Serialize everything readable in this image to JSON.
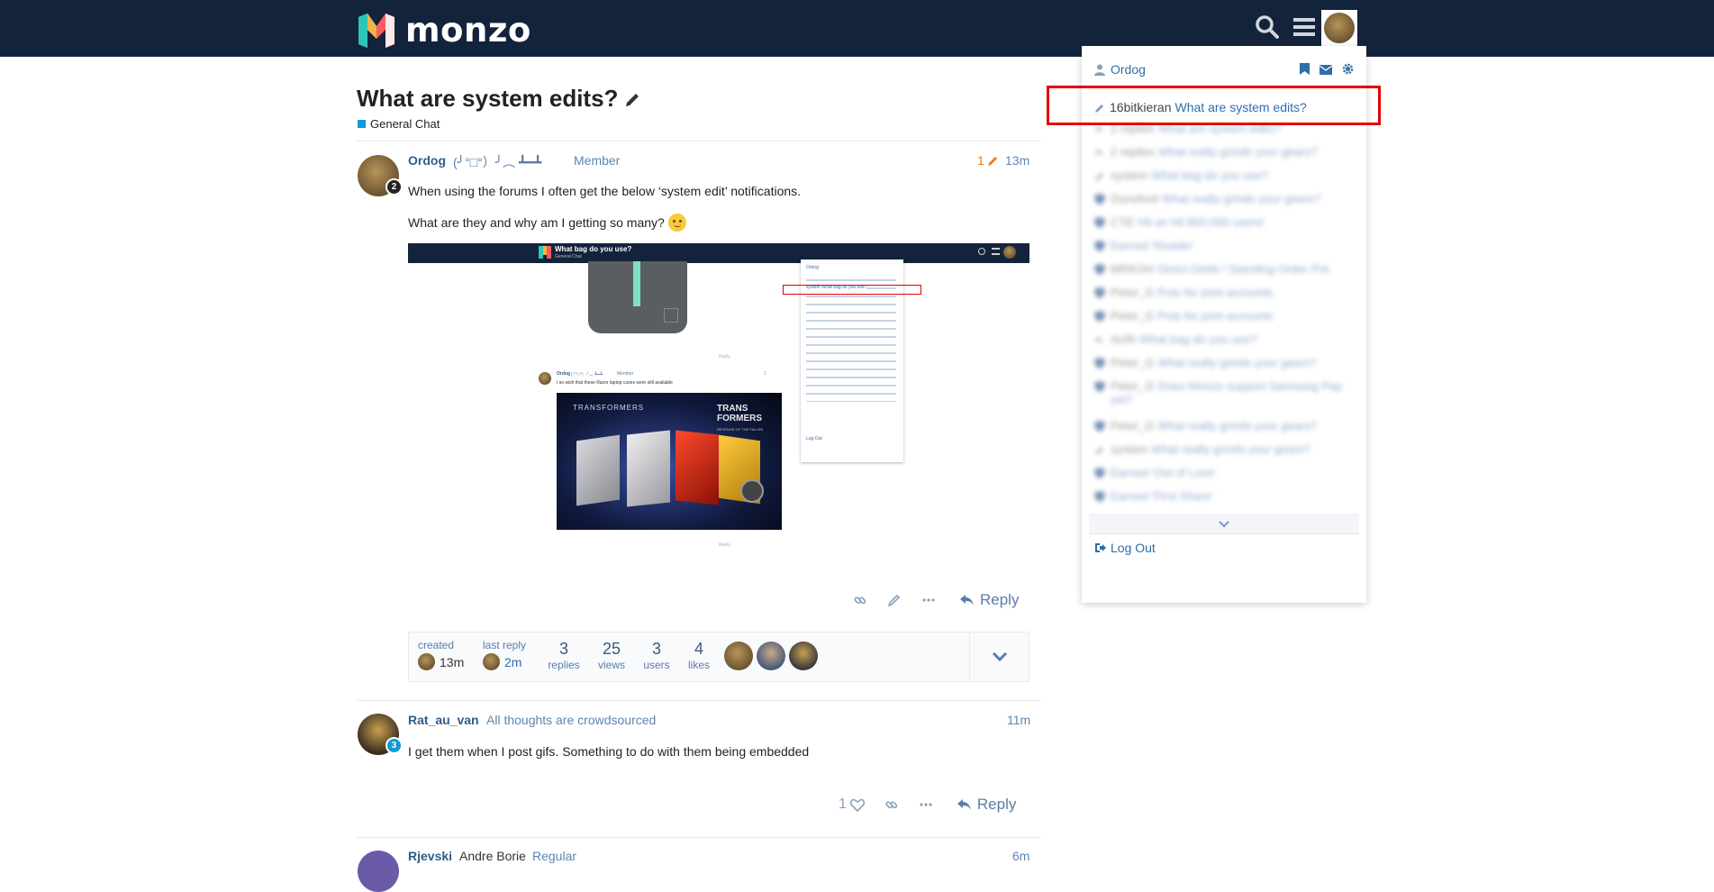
{
  "header": {
    "brand": "monzo"
  },
  "topic": {
    "title": "What are system edits?",
    "category": "General Chat"
  },
  "posts": [
    {
      "username": "Ordog",
      "flair": "(╯°□°）╯︵ ┻━┻",
      "title": "Member",
      "badge": "2",
      "edits": "1",
      "time": "13m",
      "paragraphs": [
        "When using the forums I often get the below ‘system edit’ notifications.",
        "What are they and why am I getting so many?"
      ],
      "reply_label": "Reply"
    },
    {
      "username": "Rat_au_van",
      "title": "All thoughts are crowdsourced",
      "badge": "3",
      "time": "11m",
      "text": "I get them when I post gifs. Something to do with them being embedded",
      "likes": "1",
      "reply_label": "Reply"
    },
    {
      "username": "Rjevski",
      "fullname": "Andre Borie",
      "title": "Regular",
      "time": "6m"
    }
  ],
  "topic_map": {
    "created_label": "created",
    "created_time": "13m",
    "last_reply_label": "last reply",
    "last_reply_time": "2m",
    "replies": "3",
    "replies_label": "replies",
    "views": "25",
    "views_label": "views",
    "users": "3",
    "users_label": "users",
    "likes": "4",
    "likes_label": "likes"
  },
  "embed": {
    "title": "What bag do you use?",
    "category": "General Chat",
    "user": "Ordog",
    "flair": "(╯°□°）╯︵ ┻━┻",
    "user_title": "Member",
    "edit_count": "1",
    "post_text": "I so wish that these Razor laptop cases were still available",
    "banner_text": "TRANSFORMERS",
    "poster_text": "TRANS FORMERS",
    "poster_subtitle": "REVENGE OF THE FALLEN",
    "reply_label": "Reply",
    "menu_user": "Ordog",
    "menu_highlight": "system What bag do you use?",
    "menu_logout": "Log Out"
  },
  "user_menu": {
    "username": "Ordog",
    "first_notification": {
      "user": "16bitkieran",
      "topic": "What are system edits?"
    },
    "notifications": [
      {
        "icon": "reply",
        "who": "2 replies",
        "topic": "What are system edits?"
      },
      {
        "icon": "reply",
        "who": "2 replies",
        "topic": "What really grinds your gears?"
      },
      {
        "icon": "pencil",
        "who": "system",
        "topic": "What bag do you use?"
      },
      {
        "icon": "shield",
        "who": "Dunsford",
        "topic": "What really grinds your gears?"
      },
      {
        "icon": "shield",
        "who": "CTE",
        "topic": "Hit an hit 800,000 users!"
      },
      {
        "icon": "shield",
        "who": "",
        "topic": "Earned 'Reader'"
      },
      {
        "icon": "shield",
        "who": "MRKOH",
        "topic": "Direct Debit / Standing Order Pot"
      },
      {
        "icon": "shield",
        "who": "Peter_G",
        "topic": "Pots for joint accounts"
      },
      {
        "icon": "shield",
        "who": "Peter_G",
        "topic": "Pots for joint accounts"
      },
      {
        "icon": "reply",
        "who": "rkzfh",
        "topic": "What bag do you use?"
      },
      {
        "icon": "shield",
        "who": "Peter_G",
        "topic": "What really grinds your gears?"
      },
      {
        "icon": "shield",
        "who": "Peter_G",
        "topic": "Does Monzo support Samsung Pay yet?",
        "tall": true
      },
      {
        "icon": "shield",
        "who": "Peter_G",
        "topic": "What really grinds your gears?"
      },
      {
        "icon": "pencil",
        "who": "system",
        "topic": "What really grinds your gears?"
      },
      {
        "icon": "shield",
        "who": "",
        "topic": "Earned 'Out of Love'"
      },
      {
        "icon": "shield",
        "who": "",
        "topic": "Earned 'First Share'"
      }
    ],
    "logout": "Log Out"
  },
  "colors": {
    "header_bg": "#14233c",
    "link": "#2f6ea8",
    "category": "#0e9bd6",
    "highlight_box": "#e50000",
    "edit_orange": "#e87c1e"
  }
}
